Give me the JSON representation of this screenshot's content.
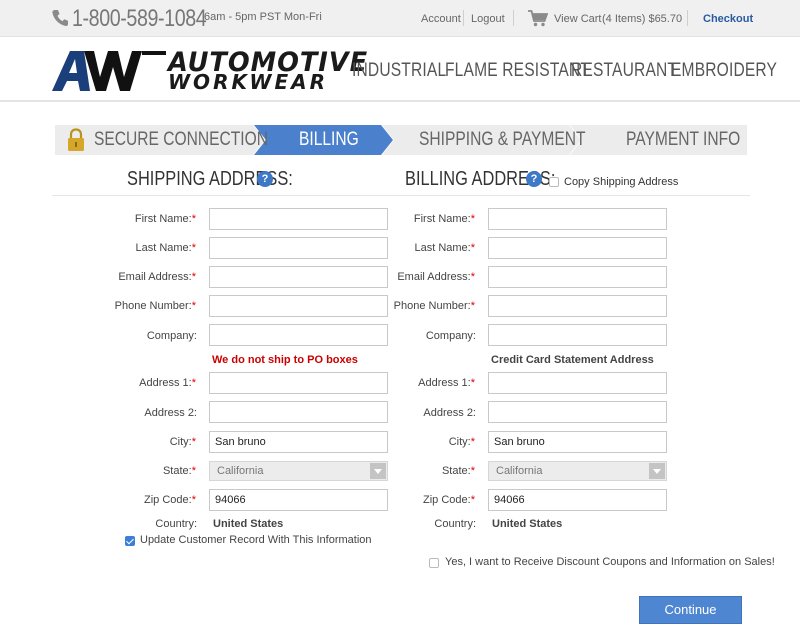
{
  "topbar": {
    "phone": "1-800-589-1084",
    "hours": "6am - 5pm PST Mon-Fri",
    "account": "Account",
    "logout": "Logout",
    "view_cart": "View Cart",
    "cart_summary": "(4 Items) $65.70",
    "checkout": "Checkout"
  },
  "header": {
    "logo_line1": "AUTOMOTIVE",
    "logo_line2": "WORKWEAR",
    "nav": [
      "INDUSTRIAL",
      "FLAME RESISTANT",
      "RESTAURANT",
      "EMBROIDERY"
    ]
  },
  "steps": {
    "items": [
      {
        "label": "SECURE CONNECTION",
        "icon": "lock-icon",
        "active": false
      },
      {
        "label": "BILLING",
        "active": true
      },
      {
        "label": "SHIPPING & PAYMENT",
        "active": false
      },
      {
        "label": "PAYMENT INFO",
        "active": false
      }
    ],
    "active_color": "#4a80cc",
    "inactive_color": "#ececec"
  },
  "shipping": {
    "title": "SHIPPING ADDRESS:",
    "first_name_label": "First Name:",
    "last_name_label": "Last Name:",
    "email_label": "Email Address:",
    "phone_label": "Phone Number:",
    "company_label": "Company:",
    "po_note": "We do not ship to PO boxes",
    "address1_label": "Address 1:",
    "address2_label": "Address 2:",
    "city_label": "City:",
    "city_value": "San bruno",
    "state_label": "State:",
    "state_value": "California",
    "zip_label": "Zip Code:",
    "zip_value": "94066",
    "country_label": "Country:",
    "country_value": "United States",
    "update_record_label": "Update Customer Record With This Information",
    "update_record_checked": true
  },
  "billing": {
    "title": "BILLING ADDRESS:",
    "copy_label": "Copy Shipping Address",
    "copy_checked": false,
    "first_name_label": "First Name:",
    "last_name_label": "Last Name:",
    "email_label": "Email Address:",
    "phone_label": "Phone Number:",
    "company_label": "Company:",
    "cc_note": "Credit Card Statement Address",
    "address1_label": "Address 1:",
    "address2_label": "Address 2:",
    "city_label": "City:",
    "city_value": "San bruno",
    "state_label": "State:",
    "state_value": "California",
    "zip_label": "Zip Code:",
    "zip_value": "94066",
    "country_label": "Country:",
    "country_value": "United States"
  },
  "help_icon": "?",
  "required_mark": "*",
  "discount_label": "Yes, I want to Receive Discount Coupons and Information on Sales!",
  "discount_checked": false,
  "continue_label": "Continue",
  "colors": {
    "accent": "#4f86d1",
    "required": "#dd0000",
    "link": "#2a5aa0"
  }
}
